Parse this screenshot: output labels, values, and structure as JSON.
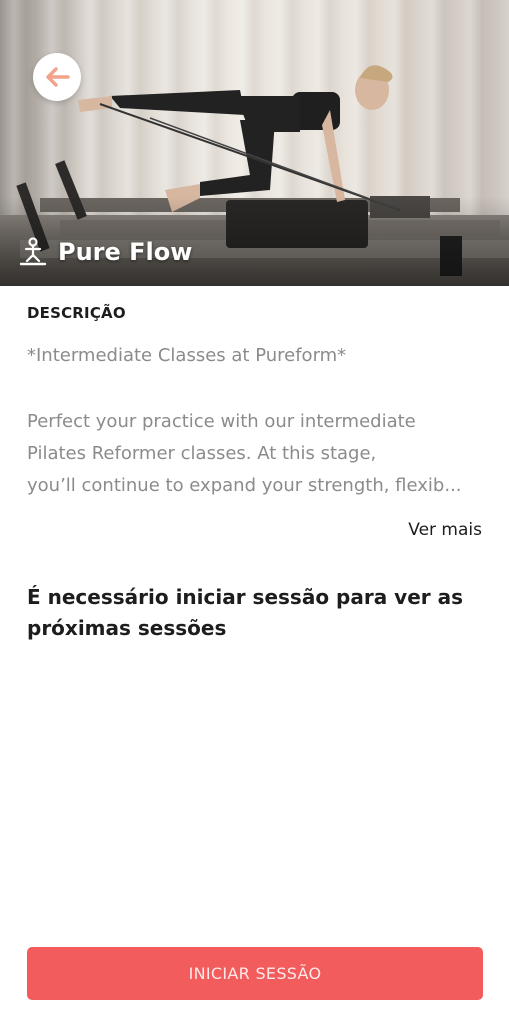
{
  "header": {
    "title": "Pure Flow",
    "back_icon": "arrow-left-icon",
    "class_icon": "pilates-icon",
    "accent_color": "#f25c5c"
  },
  "description": {
    "label": "DESCRIÇÃO",
    "lines": [
      "*Intermediate Classes at Pureform*",
      "Perfect your practice with our intermediate",
      "Pilates Reformer classes. At this stage,",
      "you’ll continue to expand your strength, flexib..."
    ],
    "see_more": "Ver mais"
  },
  "login_notice": "É necessário iniciar sessão para ver as próximas sessões",
  "login_button": "INICIAR SESSÃO"
}
